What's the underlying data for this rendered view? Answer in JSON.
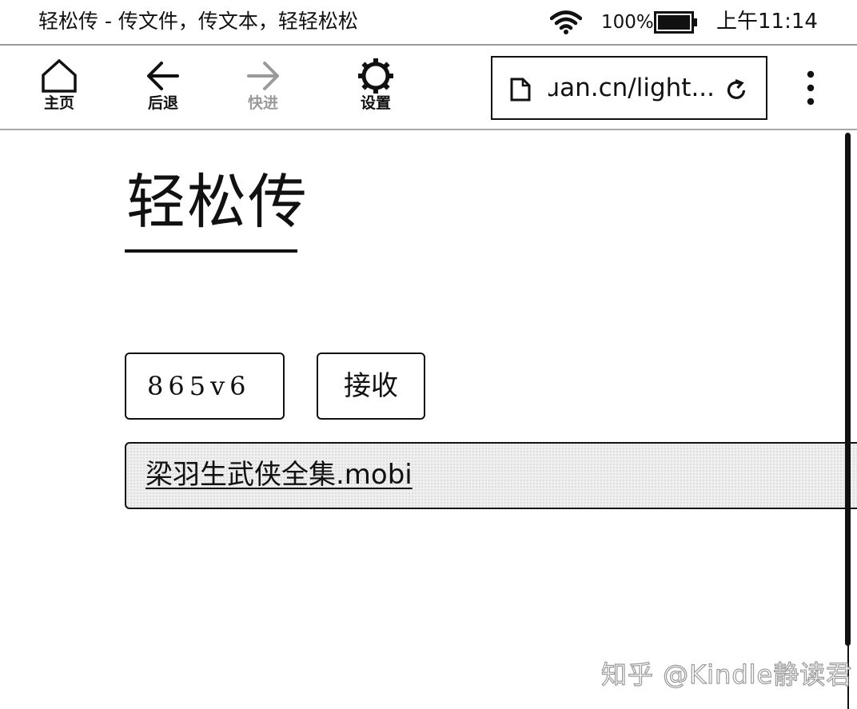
{
  "status_bar": {
    "title": "轻松传 - 传文件，传文本，轻轻松松",
    "battery_percent": "100%",
    "time": "上午11:14",
    "wifi_icon": "wifi-icon",
    "battery_icon": "battery-full-icon"
  },
  "toolbar": {
    "home_label": "主页",
    "back_label": "后退",
    "forward_label": "快进",
    "settings_label": "设置",
    "url": "...uan.cn/light/",
    "disabled_color": "#9a9a9a"
  },
  "page": {
    "title": "轻松传",
    "code_value": "865v6",
    "receive_label": "接收",
    "file_name": "梁羽生武侠全集.mobi"
  },
  "watermark": "知乎 @Kindle静读君"
}
